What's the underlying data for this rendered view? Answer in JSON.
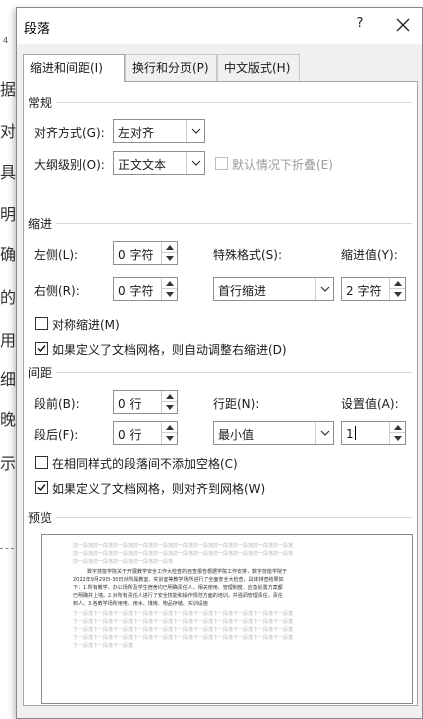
{
  "background_doc": {
    "page_number": "4",
    "chars": [
      "据",
      "对",
      "具",
      "明",
      "确",
      "的",
      "用",
      "细",
      "晚",
      "示"
    ]
  },
  "dialog": {
    "title": "段落",
    "help_label": "?",
    "tabs": [
      {
        "label": "缩进和间距(I)",
        "active": true
      },
      {
        "label": "换行和分页(P)",
        "active": false
      },
      {
        "label": "中文版式(H)",
        "active": false
      }
    ]
  },
  "general": {
    "section": "常规",
    "alignment_label": "对齐方式(G):",
    "alignment_value": "左对齐",
    "outline_label": "大纲级别(O):",
    "outline_value": "正文文本",
    "collapse_label": "默认情况下折叠(E)",
    "collapse_checked": false
  },
  "indent": {
    "section": "缩进",
    "left_label": "左侧(L):",
    "left_value": "0 字符",
    "right_label": "右侧(R):",
    "right_value": "0 字符",
    "special_label": "特殊格式(S):",
    "special_value": "首行缩进",
    "amount_label": "缩进值(Y):",
    "amount_value": "2 字符",
    "mirror_label": "对称缩进(M)",
    "mirror_checked": false,
    "auto_adjust_label": "如果定义了文档网格，则自动调整右缩进(D)",
    "auto_adjust_checked": true
  },
  "spacing": {
    "section": "间距",
    "before_label": "段前(B):",
    "before_value": "0 行",
    "after_label": "段后(F):",
    "after_value": "0 行",
    "line_spacing_label": "行距(N):",
    "line_spacing_value": "最小值",
    "at_label": "设置值(A):",
    "at_value": "1",
    "no_space_label": "在相同样式的段落间不添加空格(C)",
    "no_space_checked": false,
    "snap_grid_label": "如果定义了文档网格，则对齐到网格(W)",
    "snap_grid_checked": true
  },
  "preview": {
    "section": "预览",
    "prev_lines": [
      "前一段落前一段落前一段落前一段落前一段落前一段落前一段落前一段落前一段落前一段落前一段落",
      "前一段落前一段落前一段落前一段落前一段落前一段落前一段落前一段落前一段落前一段落前一段落",
      "前一段落前一段落前一段落前一段落前一段落"
    ],
    "sample_lines": [
      "数字技能学院关于开展教学安全工作大检查的自查报告根据学院工作安排，数字技能学院于",
      "2022年9月29日-30日对所属教室、实训室等教学场所进行了全面安全大检查，具体排查结果如",
      "下：1.所有教学、办公场所及学生宿舍均已明确责任人，相关使用、管理制度、应急处置方案都",
      "已明确并上墙。2.对所有责任人进行了安全技能和操作规范方面的培训，并强调管理责任，责任",
      "到人。3.各教学场所用电、用水、煤烤、物品存储、实训设施"
    ],
    "next_lines": [
      "下一段落下一段落下一段落下一段落下一段落下一段落下一段落下一段落下一段落下一段落下一段落",
      "下一段落下一段落下一段落下一段落下一段落下一段落下一段落下一段落下一段落下一段落下一段落",
      "下一段落下一段落下一段落下一段落下一段落下一段落下一段落下一段落下一段落下一段落下一段落",
      "下一段落下一段落下一段落下一段落下一段落下一段落下一段落下一段落下一段落下一段落下一段落",
      "下一段落下一段落下一段落"
    ]
  }
}
